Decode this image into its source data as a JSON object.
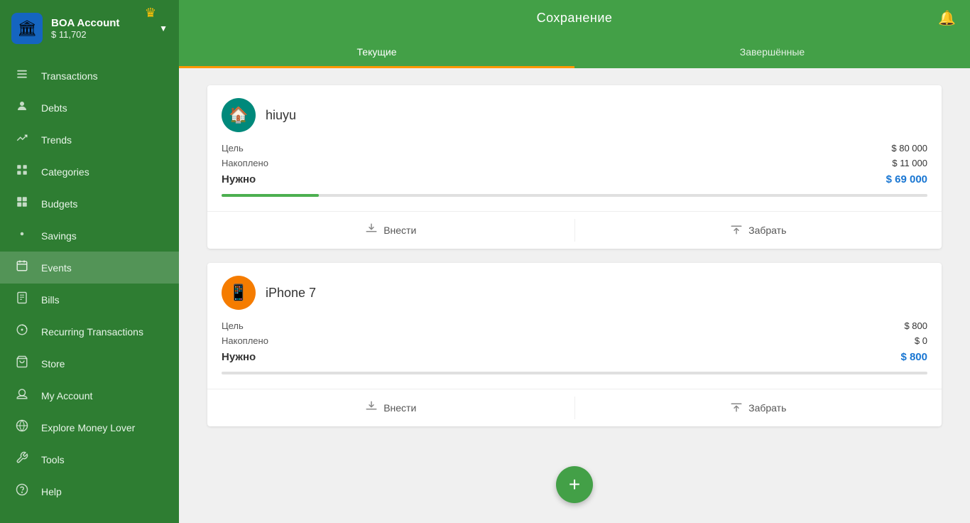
{
  "sidebar": {
    "logo_emoji": "🏛",
    "account_name": "BOA Account",
    "account_balance": "$ 11,702",
    "crown_icon": "♛",
    "dropdown_arrow": "▼",
    "nav_items": [
      {
        "id": "transactions",
        "label": "Transactions",
        "icon": "☰",
        "active": false
      },
      {
        "id": "debts",
        "label": "Debts",
        "icon": "👤",
        "active": false
      },
      {
        "id": "trends",
        "label": "Trends",
        "icon": "↗",
        "active": false
      },
      {
        "id": "categories",
        "label": "Categories",
        "icon": "⊞",
        "active": false
      },
      {
        "id": "budgets",
        "label": "Budgets",
        "icon": "▦",
        "active": false
      },
      {
        "id": "savings",
        "label": "Savings",
        "icon": "⚙",
        "active": false
      },
      {
        "id": "events",
        "label": "Events",
        "icon": "📅",
        "active": true
      },
      {
        "id": "bills",
        "label": "Bills",
        "icon": "☰",
        "active": false
      },
      {
        "id": "recurring",
        "label": "Recurring Transactions",
        "icon": "⊕",
        "active": false
      },
      {
        "id": "store",
        "label": "Store",
        "icon": "🛒",
        "active": false
      },
      {
        "id": "myaccount",
        "label": "My Account",
        "icon": "☁",
        "active": false
      },
      {
        "id": "explore",
        "label": "Explore Money Lover",
        "icon": "🌿",
        "active": false
      },
      {
        "id": "tools",
        "label": "Tools",
        "icon": "✂",
        "active": false
      },
      {
        "id": "help",
        "label": "Help",
        "icon": "❓",
        "active": false
      }
    ]
  },
  "topbar": {
    "title": "Сохранение",
    "bell_icon": "🔔",
    "tabs": [
      {
        "id": "current",
        "label": "Текущие",
        "active": true
      },
      {
        "id": "completed",
        "label": "Завершённые",
        "active": false
      }
    ]
  },
  "savings": [
    {
      "id": "hiuyu",
      "icon": "🏠",
      "icon_class": "home",
      "title": "hiuyu",
      "goal_label": "Цель",
      "goal_value": "$ 80 000",
      "saved_label": "Накоплено",
      "saved_value": "$ 11 000",
      "needed_label": "Нужно",
      "needed_value": "$ 69 000",
      "progress_percent": 13.75,
      "deposit_label": "Внести",
      "withdraw_label": "Забрать"
    },
    {
      "id": "iphone7",
      "icon": "📱",
      "icon_class": "phone",
      "title": "iPhone 7",
      "goal_label": "Цель",
      "goal_value": "$ 800",
      "saved_label": "Накоплено",
      "saved_value": "$ 0",
      "needed_label": "Нужно",
      "needed_value": "$ 800",
      "progress_percent": 0,
      "deposit_label": "Внести",
      "withdraw_label": "Забрать"
    }
  ],
  "fab": {
    "icon": "+"
  }
}
